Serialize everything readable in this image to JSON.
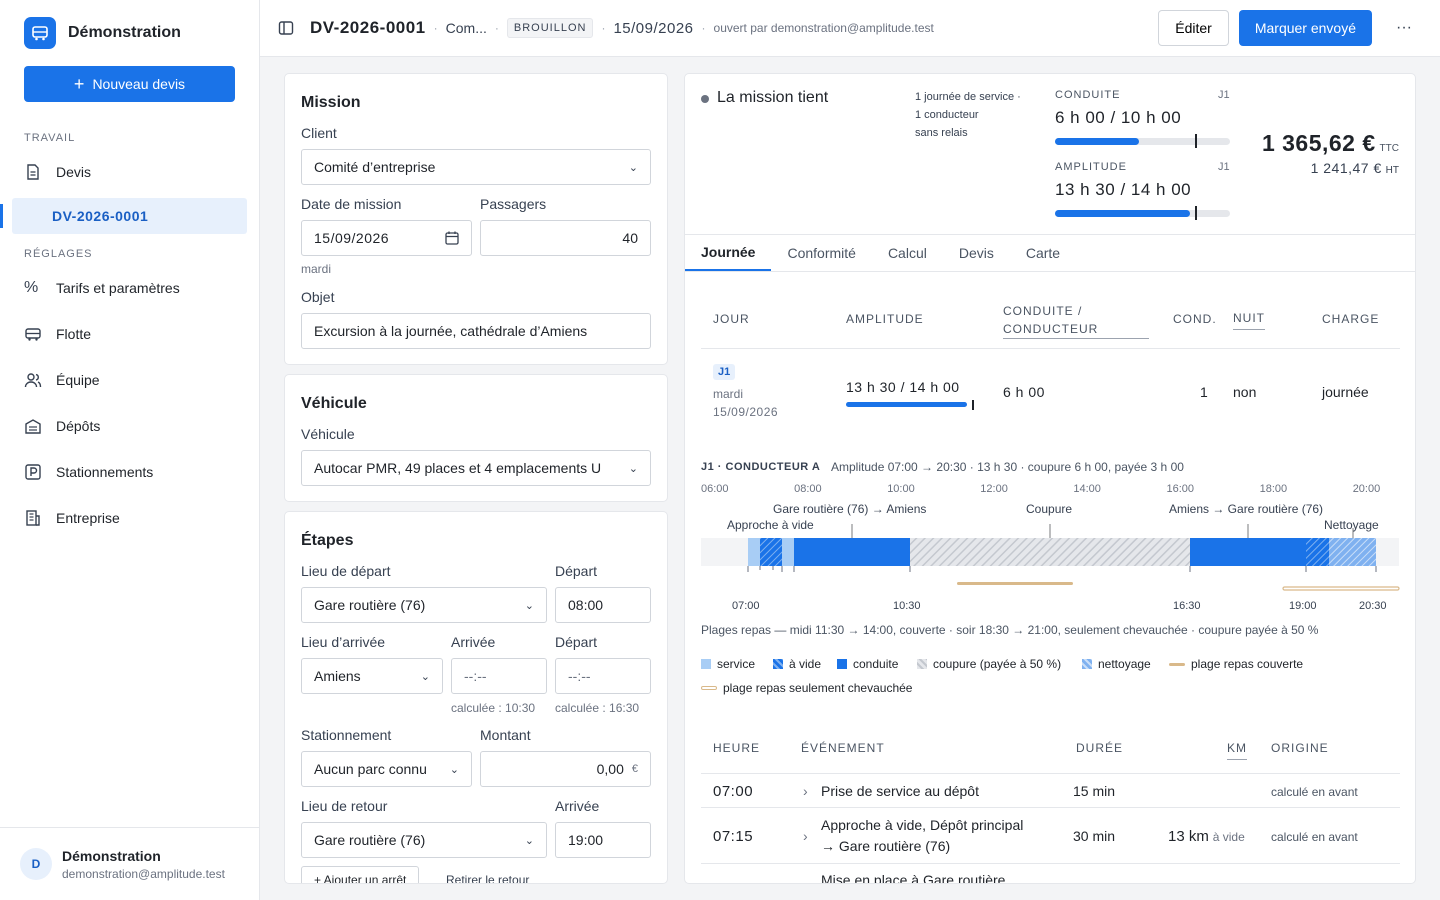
{
  "sidebar": {
    "brand": "Démonstration",
    "new_quote": "Nouveau devis",
    "sec_work": "TRAVAIL",
    "devis": "Devis",
    "active_quote": "DV-2026-0001",
    "sec_settings": "RÉGLAGES",
    "items": [
      "Tarifs et paramètres",
      "Flotte",
      "Équipe",
      "Dépôts",
      "Stationnements",
      "Entreprise"
    ],
    "user_initial": "D",
    "user_name": "Démonstration",
    "user_email": "demonstration@amplitude.test"
  },
  "topbar": {
    "title": "DV-2026-0001",
    "client": "Com...",
    "status": "BROUILLON",
    "date": "15/09/2026",
    "opened_by": "ouvert par demonstration@amplitude.test",
    "edit": "Éditer",
    "send": "Marquer envoyé"
  },
  "mission": {
    "title": "Mission",
    "client_label": "Client",
    "client_value": "Comité d’entreprise",
    "date_label": "Date de mission",
    "date_value": "15/09/2026",
    "date_hint": "mardi",
    "pax_label": "Passagers",
    "pax_value": "40",
    "object_label": "Objet",
    "object_value": "Excursion à la journée, cathédrale d’Amiens"
  },
  "vehicle": {
    "title": "Véhicule",
    "label": "Véhicule",
    "value": "Autocar PMR, 49 places et 4 emplacements U"
  },
  "steps": {
    "title": "Étapes",
    "dep_place_label": "Lieu de départ",
    "dep_place": "Gare routière (76)",
    "dep_label": "Départ",
    "dep_time": "08:00",
    "arr_place_label": "Lieu d’arrivée",
    "arr_place": "Amiens",
    "arr_label": "Arrivée",
    "arr_time": "--:--",
    "arr_hint": "calculée : 10:30",
    "dep2_label": "Départ",
    "dep2_time": "--:--",
    "dep2_hint": "calculée : 16:30",
    "park_label": "Stationnement",
    "park_value": "Aucun parc connu",
    "amount_label": "Montant",
    "amount_value": "0,00",
    "currency": "€",
    "ret_place_label": "Lieu de retour",
    "ret_place": "Gare routière (76)",
    "ret_arr_label": "Arrivée",
    "ret_time": "19:00",
    "add_stop": "+ Ajouter un arrêt",
    "remove_return": "Retirer le retour"
  },
  "summary": {
    "status": "La mission tient",
    "info": [
      "1 journée de service ·",
      "1 conducteur",
      "sans relais"
    ],
    "drive_label": "CONDUITE",
    "drive_day": "J1",
    "drive_value": "6 h 00 / 10 h 00",
    "drive_ratio": 0.6,
    "amp_label": "AMPLITUDE",
    "amp_day": "J1",
    "amp_value": "13 h 30 / 14 h 00",
    "amp_ratio": 0.964,
    "total_ttc": "1 365,62 €",
    "ttc": "TTC",
    "total_ht": "1 241,47 €",
    "ht": "HT"
  },
  "tabs": [
    "Journée",
    "Conformité",
    "Calcul",
    "Devis",
    "Carte"
  ],
  "day_table": {
    "headers": [
      "JOUR",
      "AMPLITUDE",
      "CONDUITE /",
      "CONDUCTEUR",
      "COND.",
      "NUIT",
      "CHARGE"
    ],
    "badge": "J1",
    "day": "mardi",
    "date": "15/09/2026",
    "amplitude": "13 h 30 / 14 h 00",
    "driving": "6 h 00",
    "drivers": "1",
    "night": "non",
    "charge": "journée"
  },
  "timeline": {
    "title": "J1 · CONDUCTEUR A",
    "summary": "Amplitude 07:00 → 20:30 · 13 h 30 · coupure 6 h 00, payée 3 h 00",
    "hours": [
      "06:00",
      "08:00",
      "10:00",
      "12:00",
      "14:00",
      "16:00",
      "18:00",
      "20:00"
    ],
    "labels": [
      "Gare routière (76) → Amiens",
      "Approche à vide",
      "Coupure",
      "Amiens → Gare routière (76)",
      "Nettoyage"
    ],
    "ticks": [
      "07:00",
      "10:30",
      "16:30",
      "19:00",
      "20:30"
    ],
    "meals": "Plages repas — midi 11:30 → 14:00, couverte · soir 18:30 → 21:00, seulement chevauchée · coupure payée à 50 %",
    "legend": [
      "service",
      "à vide",
      "conduite",
      "coupure (payée à 50 %)",
      "nettoyage",
      "plage repas couverte",
      "plage repas seulement chevauchée"
    ]
  },
  "events": {
    "headers": [
      "HEURE",
      "ÉVÉNEMENT",
      "DURÉE",
      "KM",
      "ORIGINE"
    ],
    "rows": [
      {
        "time": "07:00",
        "label": "Prise de service au dépôt",
        "duration": "15 min",
        "km": "",
        "km_note": "",
        "origin": "calculé en avant"
      },
      {
        "time": "07:15",
        "label": "Approche à vide, Dépôt principal",
        "label2": "→ Gare routière (76)",
        "duration": "30 min",
        "km": "13 km",
        "km_note": "à vide",
        "origin": "calculé en avant"
      },
      {
        "label": "Mise en place à Gare routière"
      }
    ]
  },
  "colors": {
    "accent": "#1a73e8",
    "service": "#a8cdf5",
    "coupure": "#d1d5db",
    "meal": "#d9b98a"
  }
}
